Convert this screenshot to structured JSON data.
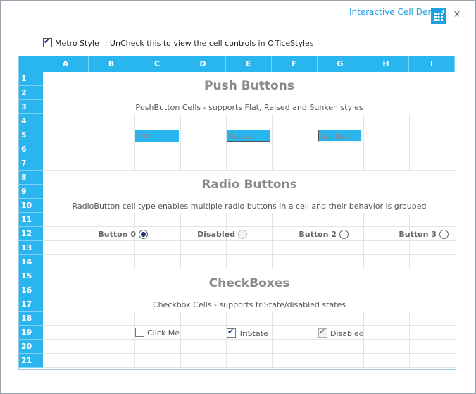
{
  "window": {
    "title": "Interactive Cell Demo",
    "close_glyph": "×",
    "app_icon": "grid-icon"
  },
  "metro": {
    "label": "Metro Style",
    "checked": true,
    "description": ": UnCheck this to view the cell controls in OfficeStyles"
  },
  "grid": {
    "columns": [
      "A",
      "B",
      "C",
      "D",
      "E",
      "F",
      "G",
      "H",
      "I"
    ],
    "rows": [
      "1",
      "2",
      "3",
      "4",
      "5",
      "6",
      "7",
      "8",
      "9",
      "10",
      "11",
      "12",
      "13",
      "14",
      "15",
      "16",
      "17",
      "18",
      "19",
      "20",
      "21"
    ],
    "header_color": "#29b6ef"
  },
  "push": {
    "title": "Push Buttons",
    "desc": "PushButton Cells - supports Flat, Raised and Sunken styles",
    "flat": "Flat",
    "raised": "Raised",
    "sunken": "Sunken"
  },
  "radio": {
    "title": "Radio Buttons",
    "desc": "RadioButton cell type enables multiple radio buttons in a cell and their behavior is grouped",
    "b0": "Button 0",
    "dis": "Disabled",
    "b2": "Button 2",
    "b3": "Button 3"
  },
  "check": {
    "title": "CheckBoxes",
    "desc": "Checkbox Cells - supports triState/disabled states",
    "click": "Click Me",
    "tri": "TriState",
    "dis": "Disabled"
  }
}
